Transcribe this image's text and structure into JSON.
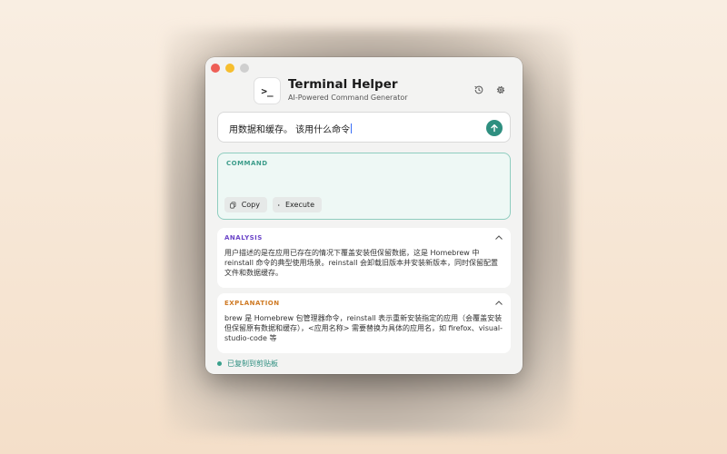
{
  "app": {
    "title": "Terminal Helper",
    "subtitle": "AI-Powered Command Generator",
    "icon_glyph": ">_"
  },
  "input": {
    "value": "用数据和缓存。 该用什么命令"
  },
  "command": {
    "label": "COMMAND",
    "copy_label": "Copy",
    "execute_label": "Execute"
  },
  "analysis": {
    "label": "ANALYSIS",
    "text": "用户描述的是在应用已存在的情况下覆盖安装但保留数据，这是 Homebrew 中 reinstall 命令的典型使用场景。reinstall 会卸载旧版本并安装新版本，同时保留配置文件和数据缓存。"
  },
  "explanation": {
    "label": "EXPLANATION",
    "text": "brew 是 Homebrew 包管理器命令，reinstall 表示重新安装指定的应用（会覆盖安装但保留原有数据和缓存），<应用名称> 需要替换为具体的应用名，如 firefox、visual-studio-code 等"
  },
  "status": {
    "text": "已复制到剪贴板"
  },
  "colors": {
    "accent": "#2f8f80",
    "analysis": "#6b45c8",
    "explanation": "#cf7a24"
  },
  "icons": {
    "history": "history-icon",
    "settings": "gear-icon",
    "send": "arrow-up-icon",
    "copy": "copy-icon",
    "execute": "play-icon",
    "collapse": "chevron-up-icon"
  }
}
